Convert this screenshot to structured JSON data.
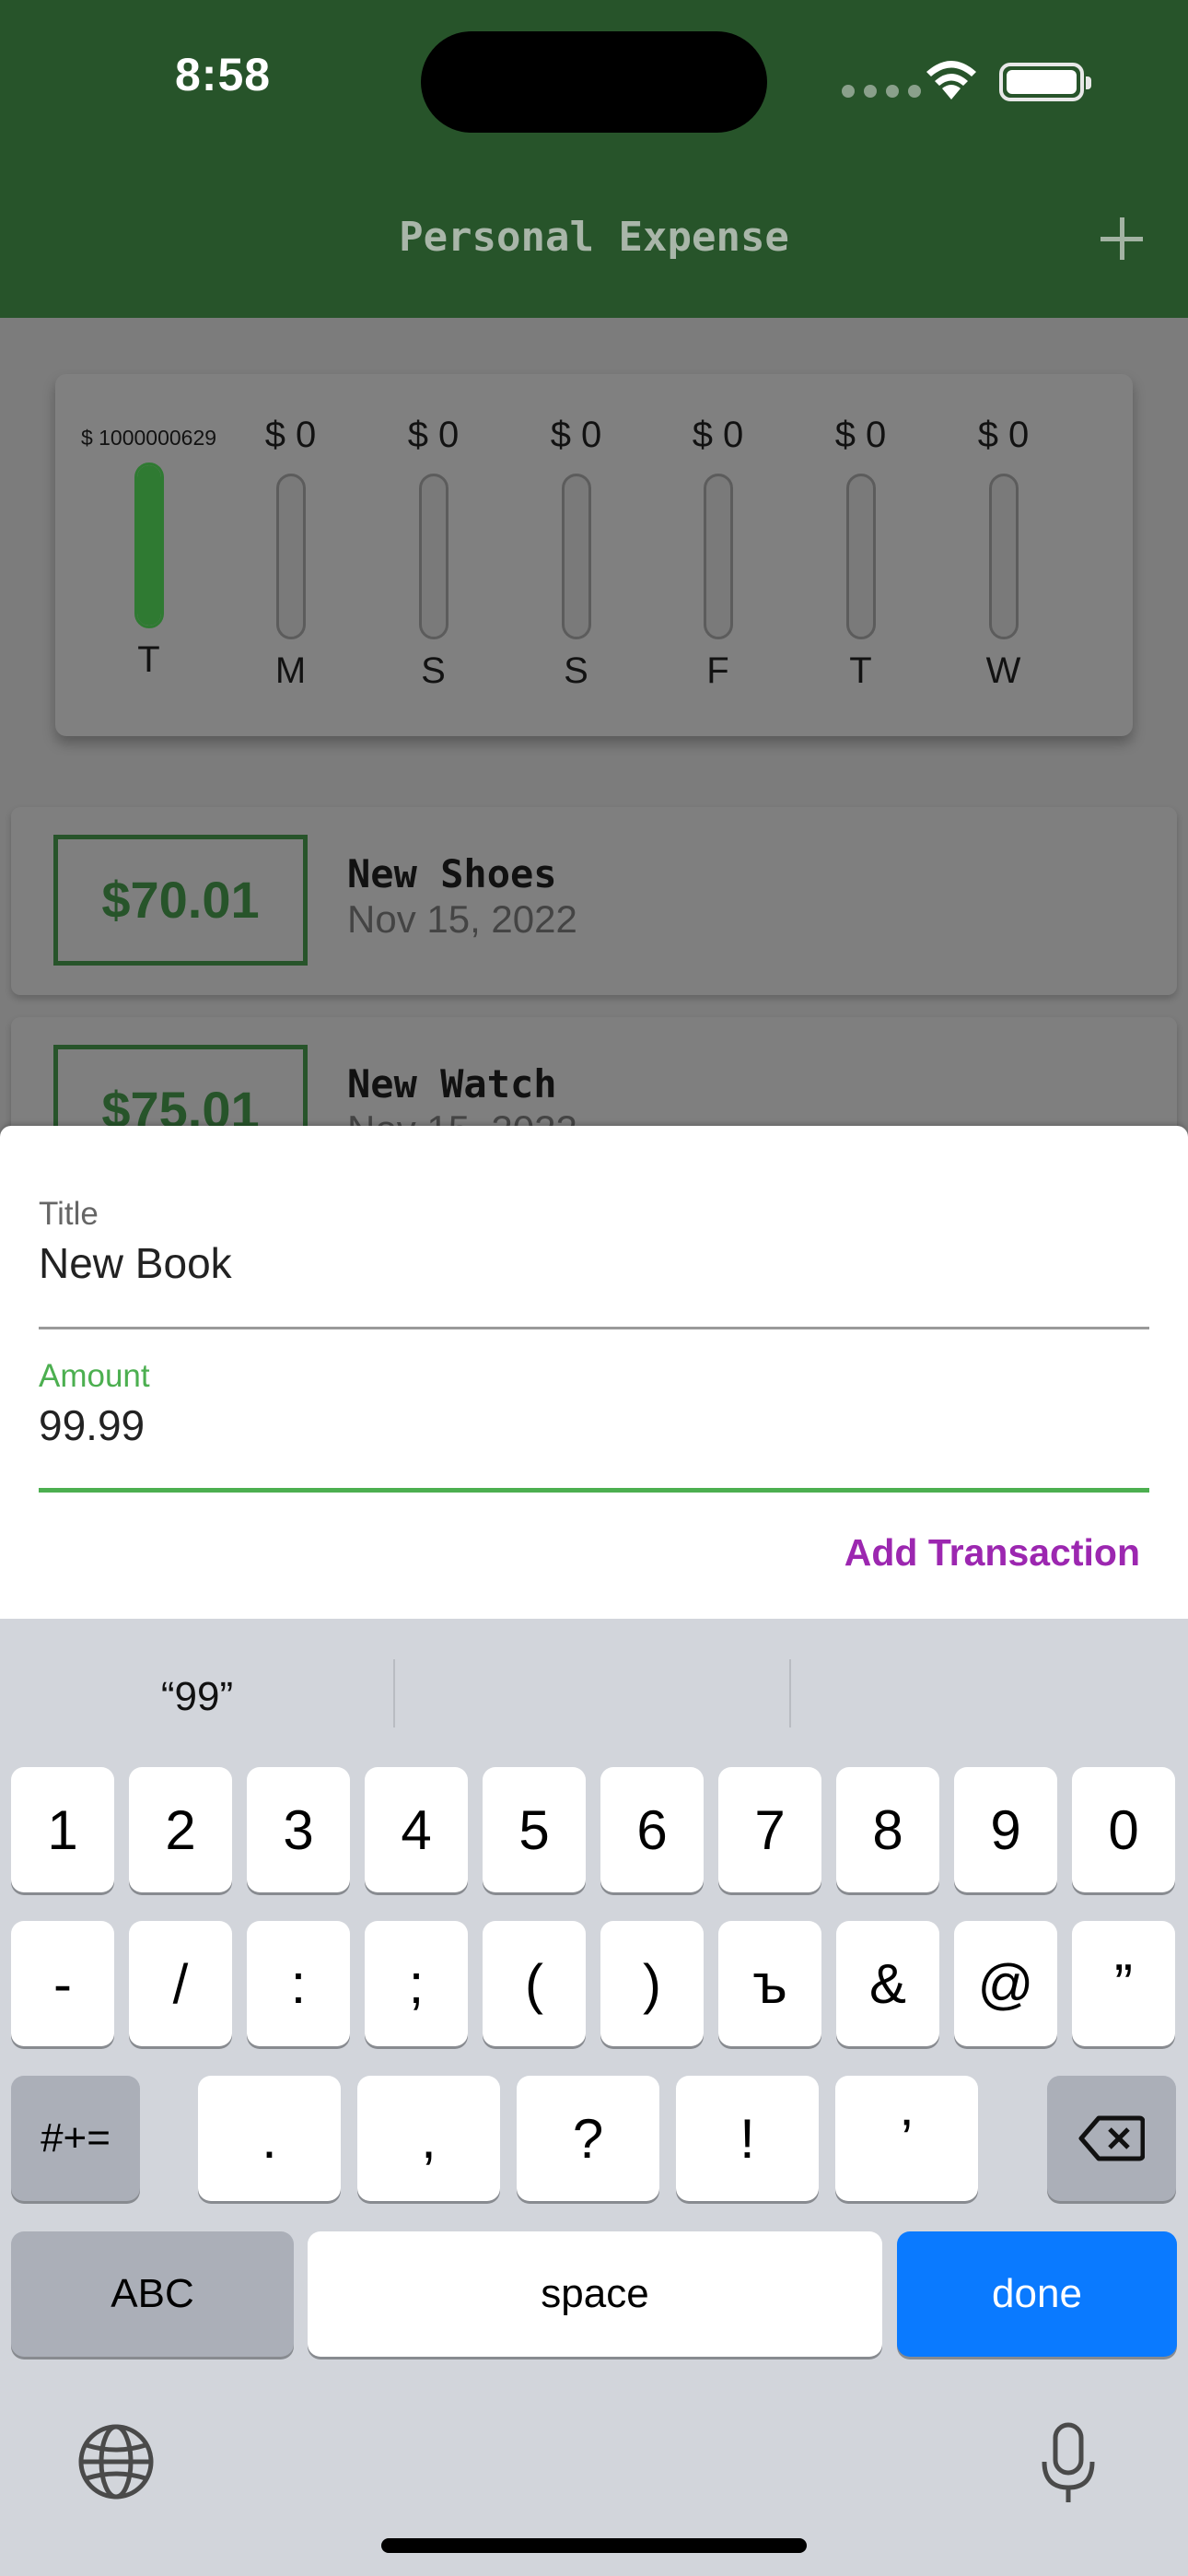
{
  "status_bar": {
    "time": "8:58"
  },
  "app_bar": {
    "title": "Personal Expense",
    "add_icon": "plus-icon"
  },
  "chart_data": {
    "type": "bar",
    "categories": [
      "T",
      "M",
      "S",
      "S",
      "F",
      "T",
      "W"
    ],
    "amount_labels": [
      "$ 1000000629",
      "$ 0",
      "$ 0",
      "$ 0",
      "$ 0",
      "$ 0",
      "$ 0"
    ],
    "fill_fraction": [
      1.0,
      0,
      0,
      0,
      0,
      0,
      0
    ],
    "colors": {
      "fill": "#2f7a32",
      "track": "#7a7a7a"
    }
  },
  "transactions": [
    {
      "amount": "$70.01",
      "title": "New Shoes",
      "date": "Nov 15, 2022"
    },
    {
      "amount": "$75.01",
      "title": "New Watch",
      "date": "Nov 15, 2022"
    }
  ],
  "form": {
    "title_label": "Title",
    "title_value": "New Book",
    "amount_label": "Amount",
    "amount_value": "99.99",
    "submit_label": "Add Transaction"
  },
  "keyboard": {
    "suggestion": "“99”",
    "row1": [
      "1",
      "2",
      "3",
      "4",
      "5",
      "6",
      "7",
      "8",
      "9",
      "0"
    ],
    "row2": [
      "-",
      "/",
      ":",
      ";",
      "(",
      ")",
      "ъ",
      "&",
      "@",
      "”"
    ],
    "row3_left": "#+=",
    "row3": [
      ".",
      ",",
      "?",
      "!",
      "’"
    ],
    "abc": "ABC",
    "space": "space",
    "done": "done",
    "icons": {
      "delete": "delete-icon",
      "globe": "globe-icon",
      "mic": "microphone-icon"
    }
  },
  "colors": {
    "app_bar": "#27542a",
    "accent_green": "#4caf50",
    "submit_purple": "#9c27b0",
    "done_blue": "#0a7aff"
  }
}
